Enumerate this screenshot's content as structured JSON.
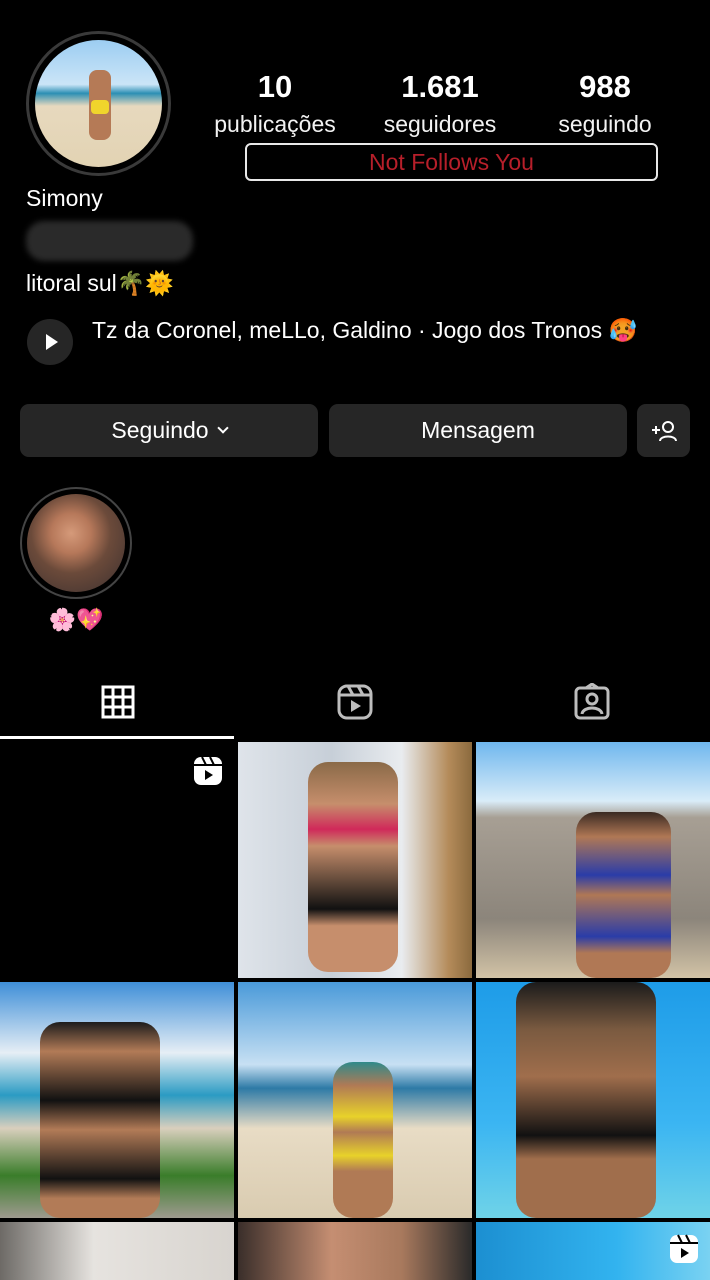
{
  "profile": {
    "name": "Simony",
    "bio": "litoral sul🌴🌞",
    "avatar_icon": "profile-photo"
  },
  "stats": {
    "posts": {
      "value": "10",
      "label": "publicações"
    },
    "followers": {
      "value": "1.681",
      "label": "seguidores"
    },
    "following": {
      "value": "988",
      "label": "seguindo"
    }
  },
  "badge": {
    "text": "Not Follows You",
    "color": "#b71f2a"
  },
  "music": {
    "text": "Tz da Coronel, meLLo, Galdino · Jogo dos Tronos 🥵"
  },
  "actions": {
    "follow_label": "Seguindo",
    "message_label": "Mensagem",
    "add_user_icon": "add-person-icon"
  },
  "highlights": [
    {
      "label": "🌸💖"
    }
  ],
  "tabs": [
    {
      "icon": "grid-icon",
      "active": true
    },
    {
      "icon": "reels-icon",
      "active": false
    },
    {
      "icon": "tagged-icon",
      "active": false
    }
  ],
  "grid": {
    "posts": [
      {
        "type": "reel"
      },
      {
        "type": "photo"
      },
      {
        "type": "photo"
      },
      {
        "type": "photo"
      },
      {
        "type": "photo"
      },
      {
        "type": "photo"
      },
      {
        "type": "photo"
      },
      {
        "type": "photo"
      },
      {
        "type": "reel"
      }
    ]
  }
}
